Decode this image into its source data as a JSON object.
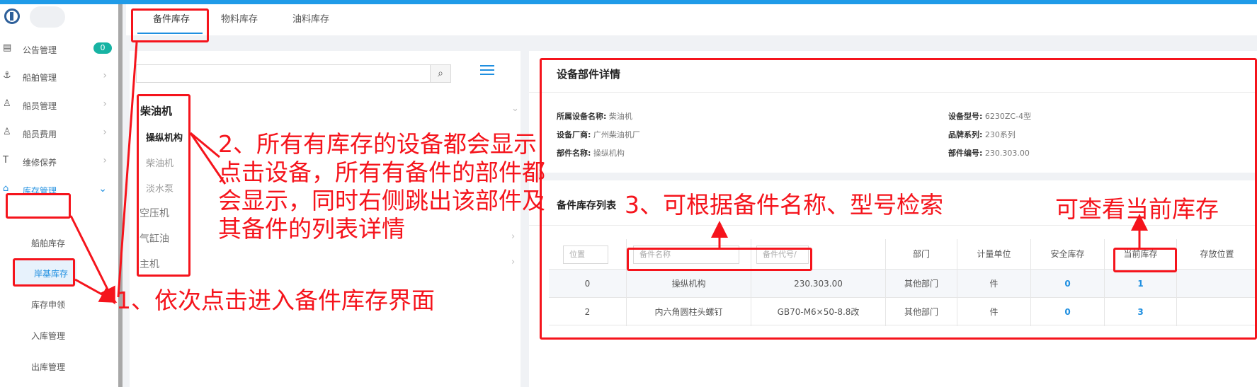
{
  "sidebar": {
    "badge_count": "0",
    "items": [
      {
        "label": "公告管理",
        "icon": "book-icon"
      },
      {
        "label": "船舶管理",
        "icon": "anchor-icon"
      },
      {
        "label": "船员管理",
        "icon": "user-icon"
      },
      {
        "label": "船员费用",
        "icon": "user-icon"
      },
      {
        "label": "维修保养",
        "icon": "hammer-icon"
      },
      {
        "label": "库存管理",
        "icon": "lock-icon"
      }
    ],
    "submenu": [
      "船舶库存",
      "岸基库存",
      "库存申领",
      "入库管理",
      "出库管理"
    ]
  },
  "tabs": [
    "备件库存",
    "物料库存",
    "油料库存"
  ],
  "tree": {
    "root": "柴油机",
    "selected": "操纵机构",
    "children": [
      "柴油机",
      "淡水泵"
    ],
    "others": [
      "空压机",
      "气缸油",
      "主机"
    ]
  },
  "detail": {
    "title": "设备部件详情",
    "fields": [
      {
        "label": "所属设备名称:",
        "value": "柴油机"
      },
      {
        "label": "设备厂商:",
        "value": "广州柴油机厂"
      },
      {
        "label": "部件名称:",
        "value": "操纵机构"
      },
      {
        "label": "设备型号:",
        "value": "6230ZC-4型"
      },
      {
        "label": "品牌系列:",
        "value": "230系列"
      },
      {
        "label": "部件编号:",
        "value": "230.303.00"
      }
    ]
  },
  "list": {
    "title": "备件库存列表",
    "headers": {
      "position_placeholder": "位置",
      "name_placeholder": "备件名称",
      "code_placeholder": "备件代号/",
      "dept": "部门",
      "unit": "计量单位",
      "safe_stock": "安全库存",
      "current_stock": "当前库存",
      "location": "存放位置"
    },
    "rows": [
      {
        "pos": "0",
        "name": "操纵机构",
        "code": "230.303.00",
        "dept": "其他部门",
        "unit": "件",
        "safe": "0",
        "current": "1",
        "loc": ""
      },
      {
        "pos": "2",
        "name": "内六角圆柱头螺钉",
        "code": "GB70-M6×50-8.8改",
        "dept": "其他部门",
        "unit": "件",
        "safe": "0",
        "current": "3",
        "loc": ""
      }
    ]
  },
  "annotations": {
    "step1": "1、依次点击进入备件库存界面",
    "step2_lines": [
      "2、所有有库存的设备都会显示",
      "点击设备，所有有备件的部件都",
      "会显示，同时右侧跳出该部件及",
      "其备件的列表详情"
    ],
    "step3": "3、可根据备件名称、型号检索",
    "current": "可查看当前库存"
  },
  "colors": {
    "accent": "#1f8fe0",
    "annotation": "#f5141c",
    "badge": "#17b3a3"
  }
}
